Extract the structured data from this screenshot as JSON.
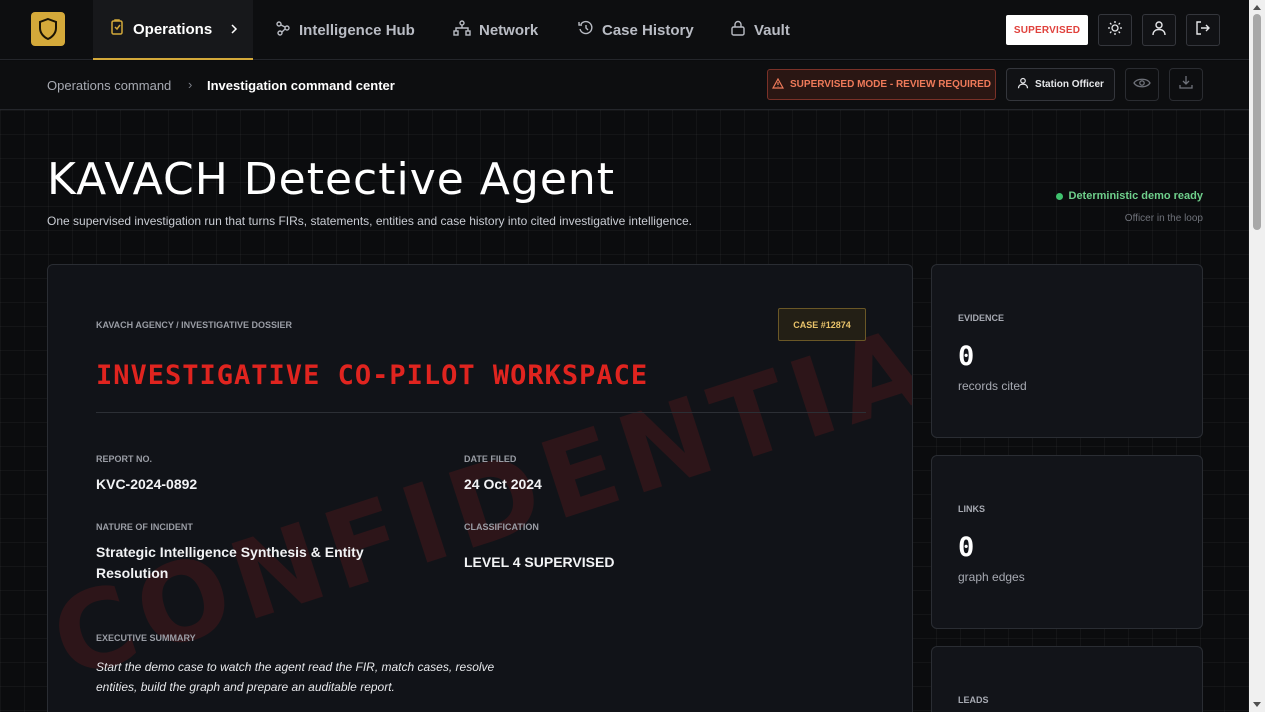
{
  "nav": {
    "items": [
      {
        "label": "Operations",
        "icon": "clipboard-icon",
        "active": true
      },
      {
        "label": "Intelligence Hub",
        "icon": "nodes-icon"
      },
      {
        "label": "Network",
        "icon": "network-icon"
      },
      {
        "label": "Case History",
        "icon": "history-icon"
      },
      {
        "label": "Vault",
        "icon": "lock-icon"
      }
    ],
    "supervised_label": "SUPERVISED"
  },
  "subbar": {
    "crumb_root": "Operations command",
    "crumb_current": "Investigation command center",
    "warning": "SUPERVISED MODE - REVIEW REQUIRED",
    "officer": "Station Officer"
  },
  "hero": {
    "title": "KAVACH Detective Agent",
    "subtitle": "One supervised investigation run that turns FIRs, statements, entities and case history into cited investigative intelligence.",
    "status": "Deterministic demo ready",
    "status_note": "Officer in the loop"
  },
  "dossier": {
    "agency": "KAVACH AGENCY / INVESTIGATIVE DOSSIER",
    "case_badge": "CASE #12874",
    "title": "INVESTIGATIVE CO-PILOT WORKSPACE",
    "watermark": "CONFIDENTIAL",
    "report_no_label": "REPORT NO.",
    "report_no": "KVC-2024-0892",
    "date_filed_label": "DATE FILED",
    "date_filed": "24 Oct 2024",
    "incident_label": "NATURE OF INCIDENT",
    "incident": "Strategic Intelligence Synthesis & Entity Resolution",
    "classification_label": "CLASSIFICATION",
    "classification": "LEVEL 4 SUPERVISED",
    "summary_label": "EXECUTIVE SUMMARY",
    "summary": "Start the demo case to watch the agent read the FIR, match cases, resolve entities, build the graph and prepare an auditable report."
  },
  "stats": [
    {
      "label": "EVIDENCE",
      "value": "0",
      "sub": "records cited"
    },
    {
      "label": "LINKS",
      "value": "0",
      "sub": "graph edges"
    },
    {
      "label": "LEADS",
      "value": "",
      "sub": ""
    }
  ],
  "colors": {
    "accent_gold": "#d4a93a",
    "alert_red": "#e0241f",
    "ok_green": "#3fc26e"
  }
}
